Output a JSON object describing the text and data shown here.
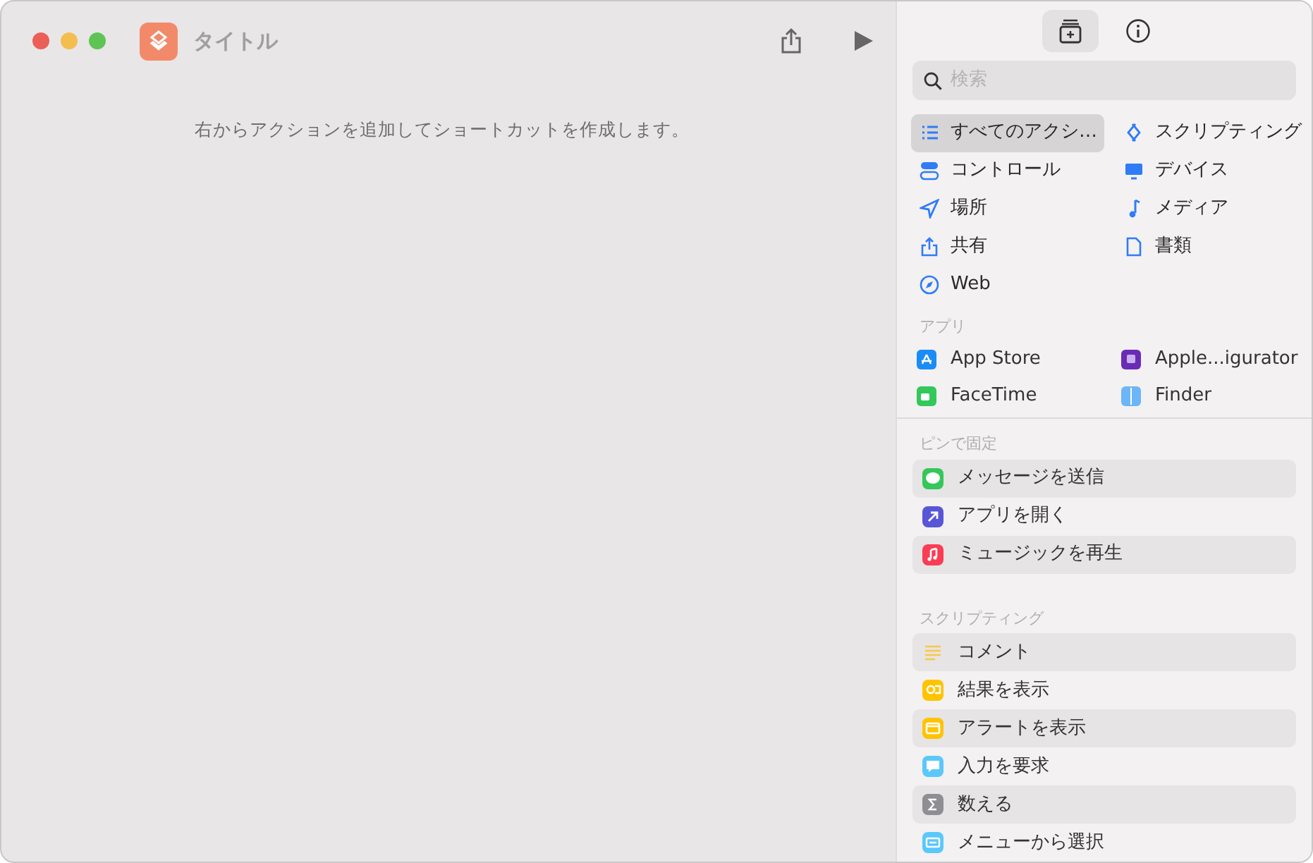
{
  "window": {
    "title": "タイトル",
    "empty_message": "右からアクションを追加してショートカットを作成します。"
  },
  "panel_tabs": [
    {
      "kind": "library",
      "selected": true
    },
    {
      "kind": "info",
      "selected": false
    }
  ],
  "search": {
    "placeholder": "検索"
  },
  "categories": [
    {
      "label": "すべてのアクシ…",
      "kind": "list",
      "selected": true
    },
    {
      "label": "スクリプティング",
      "kind": "script",
      "selected": false
    },
    {
      "label": "コントロール",
      "kind": "toggle",
      "selected": false
    },
    {
      "label": "デバイス",
      "kind": "display",
      "selected": false
    },
    {
      "label": "場所",
      "kind": "location",
      "selected": false
    },
    {
      "label": "メディア",
      "kind": "note",
      "selected": false
    },
    {
      "label": "共有",
      "kind": "share",
      "selected": false
    },
    {
      "label": "書類",
      "kind": "document",
      "selected": false
    },
    {
      "label": "Web",
      "kind": "compass",
      "selected": false
    }
  ],
  "apps": {
    "heading": "アプリ",
    "items": [
      {
        "label": "App Store",
        "kind": "appstore"
      },
      {
        "label": "Apple...igurator",
        "kind": "configurator"
      },
      {
        "label": "FaceTime",
        "kind": "facetime"
      },
      {
        "label": "Finder",
        "kind": "finder"
      }
    ]
  },
  "sections": [
    {
      "heading": "ピンで固定",
      "actions": [
        {
          "label": "メッセージを送信",
          "kind": "message",
          "color": "#34c759"
        },
        {
          "label": "アプリを開く",
          "kind": "arrow",
          "color": "#5856d6"
        },
        {
          "label": "ミュージックを再生",
          "kind": "music",
          "color": "#fa3c55"
        }
      ]
    },
    {
      "heading": "スクリプティング",
      "actions": [
        {
          "label": "コメント",
          "kind": "lines",
          "color": "#f7c948"
        },
        {
          "label": "結果を表示",
          "kind": "result",
          "color": "#ffc300"
        },
        {
          "label": "アラートを表示",
          "kind": "alert",
          "color": "#ffc300"
        },
        {
          "label": "入力を要求",
          "kind": "input",
          "color": "#5ac8fa"
        },
        {
          "label": "数える",
          "kind": "sigma",
          "color": "#8e8e93"
        },
        {
          "label": "メニューから選択",
          "kind": "menu",
          "color": "#5ac8fa"
        }
      ]
    }
  ]
}
